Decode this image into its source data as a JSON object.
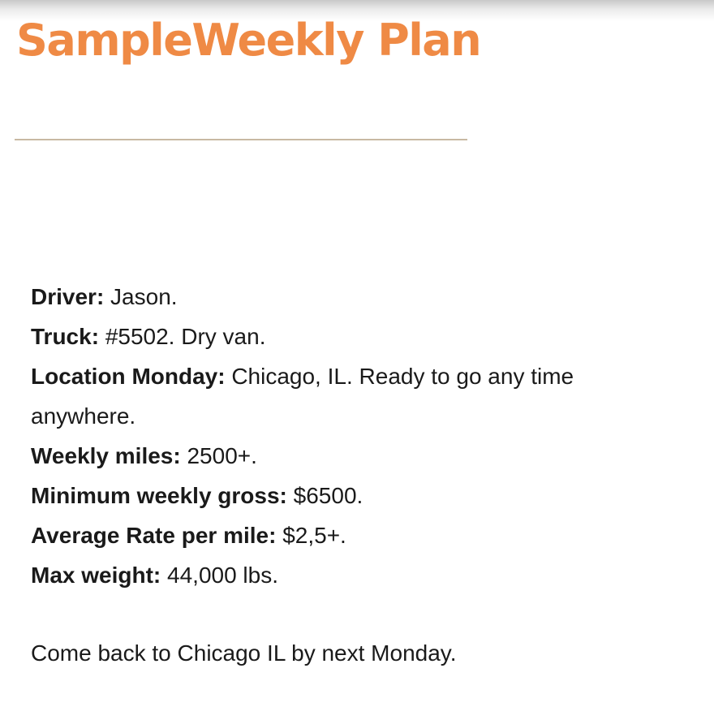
{
  "title": "SampleWeekly Plan",
  "details": [
    {
      "label": "Driver:",
      "value": "Jason."
    },
    {
      "label": "Truck:",
      "value": "#5502. Dry van."
    },
    {
      "label": "Location Monday:",
      "value": "Chicago, IL. Ready to go any time anywhere."
    },
    {
      "label": "Weekly miles:",
      "value": "2500+."
    },
    {
      "label": "Minimum weekly gross:",
      "value": "$6500."
    },
    {
      "label": "Average Rate per mile:",
      "value": "$2,5+."
    },
    {
      "label": "Max weight:",
      "value": "44,000 lbs."
    }
  ],
  "closing": "Come back to Chicago IL by next Monday.",
  "colors": {
    "title": "#ef8a45",
    "rule": "#c8b9a3",
    "text": "#1a1a1a"
  }
}
